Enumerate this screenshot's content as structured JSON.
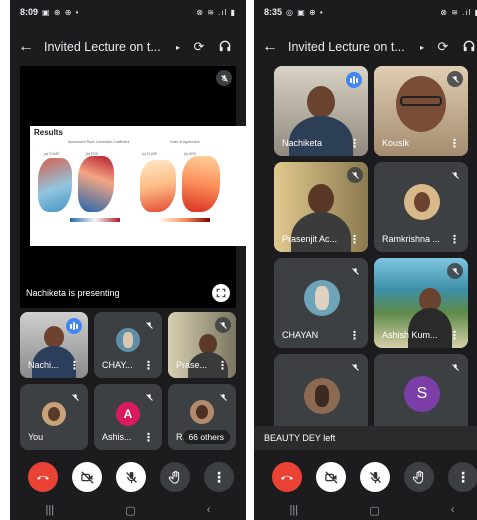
{
  "left": {
    "status": {
      "time": "8:09",
      "icons_left": "▣ ⊕ ⊕ •",
      "icons_right": "⊗ ≋ .ıl ▮"
    },
    "header": {
      "title": "Invited Lecture on t...",
      "caret": "▸",
      "back": "←",
      "switch_camera": "⟳",
      "audio": "🎧"
    },
    "slide": {
      "title": "Results",
      "caption_left": "Spearman's Rank Correlation Coefficient",
      "caption_right": "Index of Agreement",
      "map_labels": [
        "(a) CLIMP",
        "(b) ERS",
        "(c) CLIMP",
        "(d) ERS"
      ]
    },
    "presenting_text": "Nachiketa is presenting",
    "tiles": [
      {
        "name": "Nachi..."
      },
      {
        "name": "CHAY..."
      },
      {
        "name": "Prase..."
      },
      {
        "name": "You"
      },
      {
        "name": "Ashis...",
        "initial": "A"
      },
      {
        "name": "R...",
        "others": "66 others"
      }
    ]
  },
  "right": {
    "status": {
      "time": "8:35",
      "icons_left": "◎ ▣ ⊕ •",
      "icons_right": "⊗ ≋ .ıl ▮"
    },
    "header": {
      "title": "Invited Lecture on t...",
      "caret": "▸",
      "back": "←",
      "switch_camera": "⟳",
      "audio": "🎧"
    },
    "tiles": [
      {
        "name": "Nachiketa"
      },
      {
        "name": "Kousik"
      },
      {
        "name": "Prasenjit Ac..."
      },
      {
        "name": "Ramkrishna ..."
      },
      {
        "name": "CHAYAN"
      },
      {
        "name": "Ashish Kum..."
      },
      {
        "name": ""
      },
      {
        "name": "",
        "initial": "S"
      }
    ],
    "toast": "BEAUTY DEY left"
  },
  "controls": {
    "end_call": "end-call",
    "camera": "camera-off",
    "mic": "mic-off",
    "raise_hand": "raise-hand",
    "more": "⋮"
  },
  "navbar": {
    "recent": "|||",
    "home": "▢",
    "back": "‹"
  },
  "colors": {
    "end_call": "#ea4335",
    "tile": "#3c4043",
    "speaking": "#4285f4",
    "avatar_a": "#d81b60",
    "avatar_s": "#7b3fa7"
  }
}
